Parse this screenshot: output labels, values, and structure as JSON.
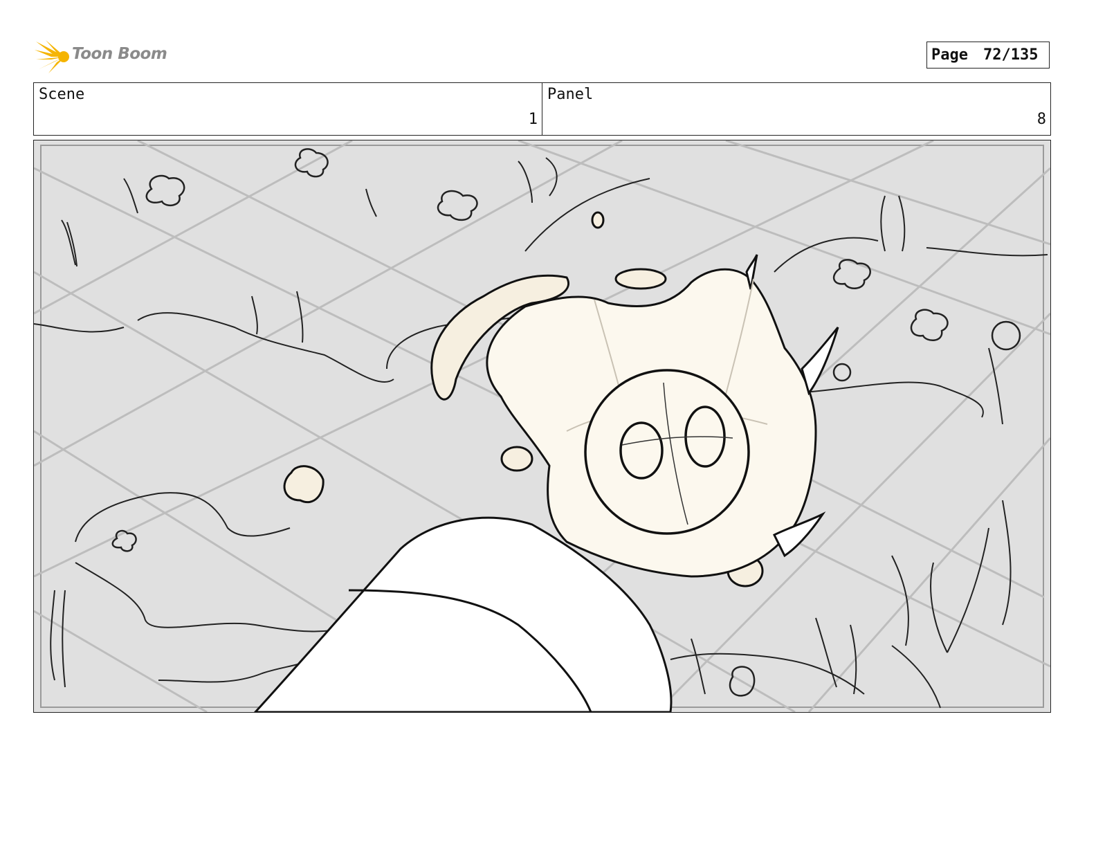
{
  "logo": {
    "text": "Toon Boom"
  },
  "page": {
    "label": "Page",
    "value": "72/135"
  },
  "scene": {
    "label": "Scene",
    "value": "1"
  },
  "panel": {
    "label": "Panel",
    "value": "8"
  },
  "colors": {
    "background": "#e0e0e0",
    "character_fill": "#fcf8ee",
    "line": "#111111",
    "logo_burst": "#f5b400"
  }
}
